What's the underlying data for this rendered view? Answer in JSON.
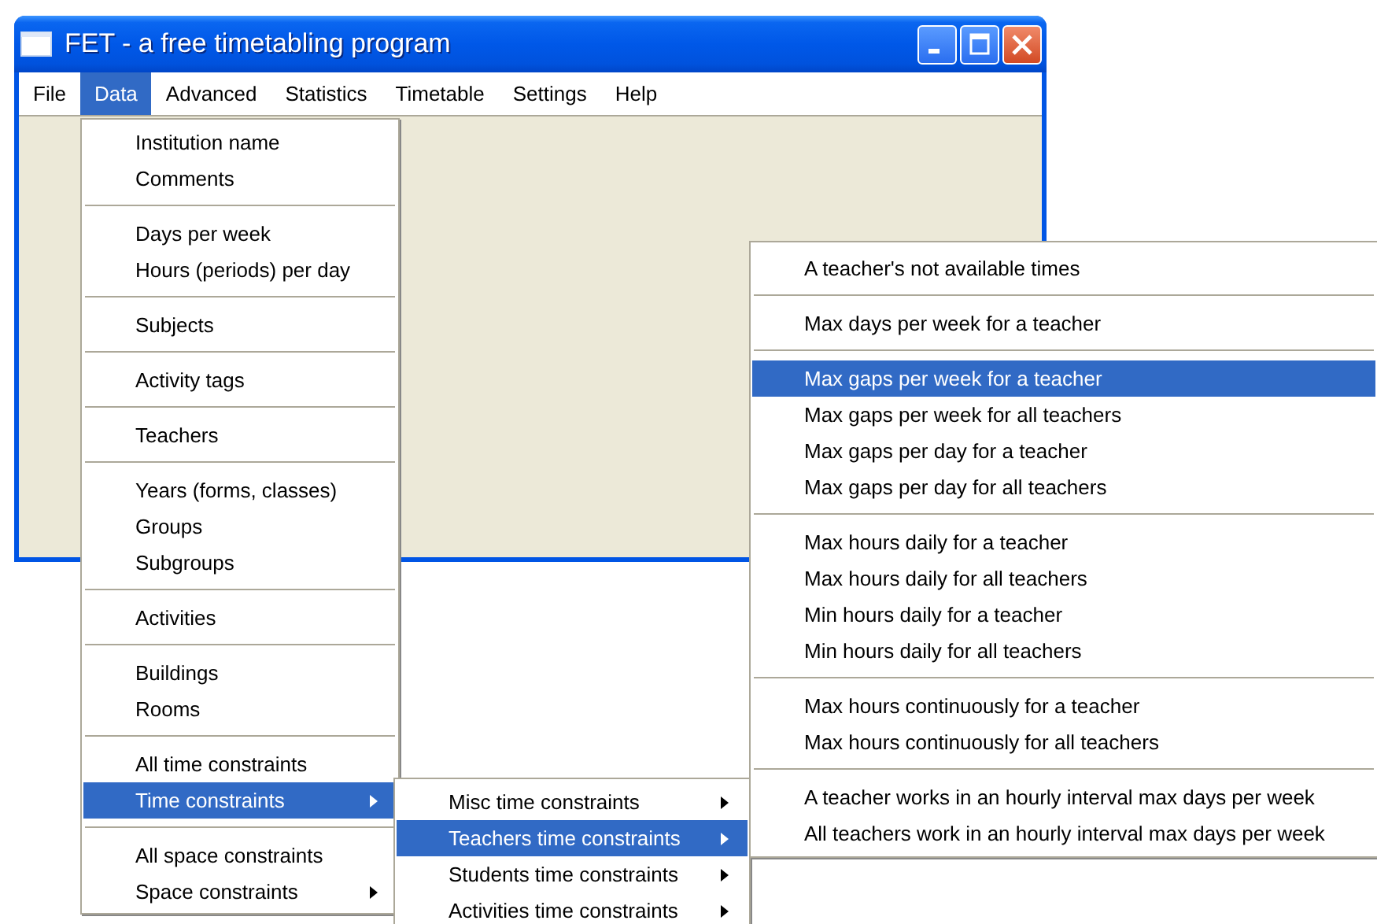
{
  "window": {
    "title": "FET - a free timetabling program"
  },
  "menubar": [
    {
      "label": "File",
      "selected": false
    },
    {
      "label": "Data",
      "selected": true
    },
    {
      "label": "Advanced",
      "selected": false
    },
    {
      "label": "Statistics",
      "selected": false
    },
    {
      "label": "Timetable",
      "selected": false
    },
    {
      "label": "Settings",
      "selected": false
    },
    {
      "label": "Help",
      "selected": false
    }
  ],
  "menus": [
    {
      "groups": [
        [
          {
            "label": "Institution name",
            "selected": false,
            "submenu": false
          },
          {
            "label": "Comments",
            "selected": false,
            "submenu": false
          }
        ],
        [
          {
            "label": "Days per week",
            "selected": false,
            "submenu": false
          },
          {
            "label": "Hours (periods) per day",
            "selected": false,
            "submenu": false
          }
        ],
        [
          {
            "label": "Subjects",
            "selected": false,
            "submenu": false
          }
        ],
        [
          {
            "label": "Activity tags",
            "selected": false,
            "submenu": false
          }
        ],
        [
          {
            "label": "Teachers",
            "selected": false,
            "submenu": false
          }
        ],
        [
          {
            "label": "Years (forms, classes)",
            "selected": false,
            "submenu": false
          },
          {
            "label": "Groups",
            "selected": false,
            "submenu": false
          },
          {
            "label": "Subgroups",
            "selected": false,
            "submenu": false
          }
        ],
        [
          {
            "label": "Activities",
            "selected": false,
            "submenu": false
          }
        ],
        [
          {
            "label": "Buildings",
            "selected": false,
            "submenu": false
          },
          {
            "label": "Rooms",
            "selected": false,
            "submenu": false
          }
        ],
        [
          {
            "label": "All time constraints",
            "selected": false,
            "submenu": false
          },
          {
            "label": "Time constraints",
            "selected": true,
            "submenu": true
          }
        ],
        [
          {
            "label": "All space constraints",
            "selected": false,
            "submenu": false
          },
          {
            "label": "Space constraints",
            "selected": false,
            "submenu": true
          }
        ]
      ]
    },
    {
      "groups": [
        [
          {
            "label": "Misc time constraints",
            "selected": false,
            "submenu": true
          },
          {
            "label": "Teachers time constraints",
            "selected": true,
            "submenu": true
          },
          {
            "label": "Students time constraints",
            "selected": false,
            "submenu": true
          },
          {
            "label": "Activities time constraints",
            "selected": false,
            "submenu": true
          }
        ]
      ]
    },
    {
      "groups": [
        [
          {
            "label": "A teacher's not available times",
            "selected": false,
            "submenu": false
          }
        ],
        [
          {
            "label": "Max days per week for a teacher",
            "selected": false,
            "submenu": false
          }
        ],
        [
          {
            "label": "Max gaps per week for a teacher",
            "selected": true,
            "submenu": false
          },
          {
            "label": "Max gaps per week for all teachers",
            "selected": false,
            "submenu": false
          },
          {
            "label": "Max gaps per day for a teacher",
            "selected": false,
            "submenu": false
          },
          {
            "label": "Max gaps per day for all teachers",
            "selected": false,
            "submenu": false
          }
        ],
        [
          {
            "label": "Max hours daily for a teacher",
            "selected": false,
            "submenu": false
          },
          {
            "label": "Max hours daily for all teachers",
            "selected": false,
            "submenu": false
          },
          {
            "label": "Min hours daily for a teacher",
            "selected": false,
            "submenu": false
          },
          {
            "label": "Min hours daily for all teachers",
            "selected": false,
            "submenu": false
          }
        ],
        [
          {
            "label": "Max hours continuously for a teacher",
            "selected": false,
            "submenu": false
          },
          {
            "label": "Max hours continuously for all teachers",
            "selected": false,
            "submenu": false
          }
        ],
        [
          {
            "label": "A teacher works in an hourly interval max days per week",
            "selected": false,
            "submenu": false
          },
          {
            "label": "All teachers work in an hourly interval max days per week",
            "selected": false,
            "submenu": false
          }
        ]
      ]
    }
  ]
}
